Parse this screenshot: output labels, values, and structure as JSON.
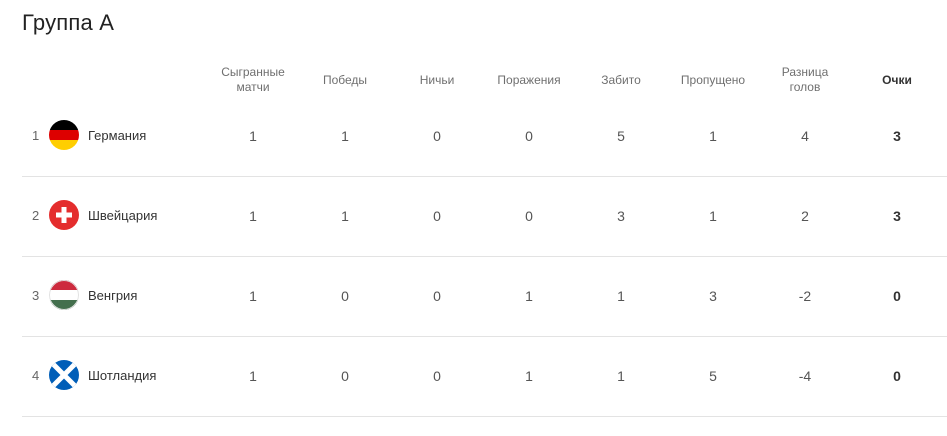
{
  "title": "Группа А",
  "columns": [
    "Сыгранные матчи",
    "Победы",
    "Ничьи",
    "Поражения",
    "Забито",
    "Пропущено",
    "Разница голов",
    "Очки"
  ],
  "rows": [
    {
      "pos": "1",
      "team": "Германия",
      "flag": "germany-flag-icon",
      "played": "1",
      "won": "1",
      "draw": "0",
      "lost": "0",
      "scored": "5",
      "conceded": "1",
      "diff": "4",
      "points": "3"
    },
    {
      "pos": "2",
      "team": "Швейцария",
      "flag": "switzerland-flag-icon",
      "played": "1",
      "won": "1",
      "draw": "0",
      "lost": "0",
      "scored": "3",
      "conceded": "1",
      "diff": "2",
      "points": "3"
    },
    {
      "pos": "3",
      "team": "Венгрия",
      "flag": "hungary-flag-icon",
      "played": "1",
      "won": "0",
      "draw": "0",
      "lost": "1",
      "scored": "1",
      "conceded": "3",
      "diff": "-2",
      "points": "0"
    },
    {
      "pos": "4",
      "team": "Шотландия",
      "flag": "scotland-flag-icon",
      "played": "1",
      "won": "0",
      "draw": "0",
      "lost": "1",
      "scored": "1",
      "conceded": "5",
      "diff": "-4",
      "points": "0"
    }
  ],
  "colors": {
    "germany": [
      "#000000",
      "#dd0000",
      "#ffce00"
    ],
    "switzerland": [
      "#e42d2d",
      "#ffffff"
    ],
    "hungary": [
      "#cd2a3e",
      "#ffffff",
      "#436f4d"
    ],
    "scotland": [
      "#005eb8",
      "#ffffff"
    ]
  }
}
